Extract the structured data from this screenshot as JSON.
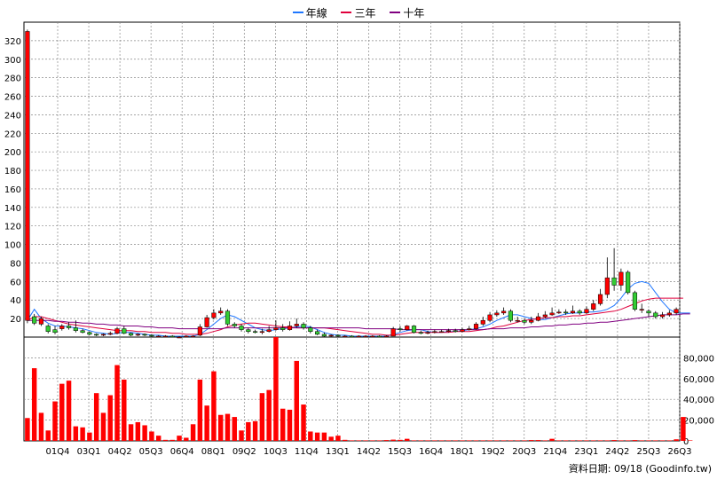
{
  "chart_data": {
    "type": "candlestick_with_volume",
    "legend": [
      {
        "label": "年線",
        "color": "#1f77ff"
      },
      {
        "label": "三年",
        "color": "#e0003c"
      },
      {
        "label": "十年",
        "color": "#800080"
      }
    ],
    "price_axis": {
      "ylim": [
        0,
        340
      ],
      "ticks": [
        20,
        40,
        60,
        80,
        100,
        120,
        140,
        160,
        180,
        200,
        220,
        240,
        260,
        280,
        300,
        320
      ]
    },
    "volume_axis": {
      "ylim": [
        0,
        100000
      ],
      "ticks": [
        "0",
        "20,000",
        "40,000",
        "60,000",
        "80,000"
      ],
      "tick_values": [
        0,
        20000,
        40000,
        60000,
        80000
      ]
    },
    "x_labels": [
      "01Q4",
      "03Q1",
      "04Q2",
      "05Q3",
      "06Q4",
      "08Q1",
      "09Q2",
      "10Q3",
      "11Q4",
      "13Q1",
      "14Q2",
      "15Q3",
      "16Q4",
      "18Q1",
      "19Q2",
      "20Q3",
      "21Q4",
      "23Q1",
      "24Q2",
      "25Q3",
      "26Q3"
    ],
    "candles": [
      {
        "o": 18,
        "c": 330,
        "h": 332,
        "l": 15
      },
      {
        "o": 22,
        "c": 15,
        "h": 25,
        "l": 13
      },
      {
        "o": 14,
        "c": 20,
        "h": 22,
        "l": 12
      },
      {
        "o": 12,
        "c": 6,
        "h": 14,
        "l": 4
      },
      {
        "o": 8,
        "c": 5,
        "h": 12,
        "l": 3
      },
      {
        "o": 9,
        "c": 12,
        "h": 14,
        "l": 7
      },
      {
        "o": 12,
        "c": 10,
        "h": 16,
        "l": 8
      },
      {
        "o": 10,
        "c": 7,
        "h": 18,
        "l": 5
      },
      {
        "o": 7,
        "c": 5,
        "h": 9,
        "l": 4
      },
      {
        "o": 5,
        "c": 3,
        "h": 6,
        "l": 2
      },
      {
        "o": 3,
        "c": 2,
        "h": 4,
        "l": 1
      },
      {
        "o": 2,
        "c": 3,
        "h": 4,
        "l": 1
      },
      {
        "o": 3,
        "c": 4,
        "h": 6,
        "l": 2
      },
      {
        "o": 4,
        "c": 9,
        "h": 11,
        "l": 3
      },
      {
        "o": 9,
        "c": 4,
        "h": 12,
        "l": 3
      },
      {
        "o": 4,
        "c": 2,
        "h": 5,
        "l": 1
      },
      {
        "o": 2,
        "c": 3,
        "h": 4,
        "l": 1
      },
      {
        "o": 3,
        "c": 2,
        "h": 4,
        "l": 1
      },
      {
        "o": 2,
        "c": 1,
        "h": 3,
        "l": 0
      },
      {
        "o": 1,
        "c": 1,
        "h": 2,
        "l": 0
      },
      {
        "o": 1,
        "c": 1,
        "h": 2,
        "l": 0
      },
      {
        "o": 1,
        "c": 0,
        "h": 2,
        "l": 0
      },
      {
        "o": 0,
        "c": 0,
        "h": 1,
        "l": 0
      },
      {
        "o": 0,
        "c": 1,
        "h": 2,
        "l": 0
      },
      {
        "o": 1,
        "c": 1,
        "h": 2,
        "l": 0
      },
      {
        "o": 2,
        "c": 11,
        "h": 14,
        "l": 1
      },
      {
        "o": 11,
        "c": 21,
        "h": 24,
        "l": 10
      },
      {
        "o": 21,
        "c": 26,
        "h": 30,
        "l": 19
      },
      {
        "o": 26,
        "c": 28,
        "h": 32,
        "l": 24
      },
      {
        "o": 28,
        "c": 14,
        "h": 30,
        "l": 12
      },
      {
        "o": 14,
        "c": 12,
        "h": 16,
        "l": 10
      },
      {
        "o": 12,
        "c": 8,
        "h": 14,
        "l": 6
      },
      {
        "o": 8,
        "c": 6,
        "h": 10,
        "l": 4
      },
      {
        "o": 6,
        "c": 5,
        "h": 8,
        "l": 4
      },
      {
        "o": 5,
        "c": 6,
        "h": 9,
        "l": 3
      },
      {
        "o": 6,
        "c": 8,
        "h": 12,
        "l": 5
      },
      {
        "o": 8,
        "c": 10,
        "h": 18,
        "l": 7
      },
      {
        "o": 10,
        "c": 8,
        "h": 14,
        "l": 6
      },
      {
        "o": 8,
        "c": 12,
        "h": 17,
        "l": 7
      },
      {
        "o": 12,
        "c": 14,
        "h": 20,
        "l": 10
      },
      {
        "o": 14,
        "c": 10,
        "h": 16,
        "l": 8
      },
      {
        "o": 10,
        "c": 6,
        "h": 12,
        "l": 4
      },
      {
        "o": 6,
        "c": 3,
        "h": 8,
        "l": 2
      },
      {
        "o": 3,
        "c": 1,
        "h": 5,
        "l": 0
      },
      {
        "o": 1,
        "c": 2,
        "h": 3,
        "l": 0
      },
      {
        "o": 2,
        "c": 1,
        "h": 3,
        "l": 0
      },
      {
        "o": 1,
        "c": 1,
        "h": 2,
        "l": 0
      },
      {
        "o": 1,
        "c": 0,
        "h": 2,
        "l": 0
      },
      {
        "o": 0,
        "c": 1,
        "h": 2,
        "l": 0
      },
      {
        "o": 1,
        "c": 1,
        "h": 2,
        "l": 0
      },
      {
        "o": 1,
        "c": 1,
        "h": 2,
        "l": 0
      },
      {
        "o": 1,
        "c": 0,
        "h": 2,
        "l": 0
      },
      {
        "o": 0,
        "c": 1,
        "h": 2,
        "l": 0
      },
      {
        "o": 1,
        "c": 9,
        "h": 11,
        "l": 1
      },
      {
        "o": 9,
        "c": 8,
        "h": 12,
        "l": 6
      },
      {
        "o": 8,
        "c": 12,
        "h": 13,
        "l": 7
      },
      {
        "o": 12,
        "c": 5,
        "h": 13,
        "l": 4
      },
      {
        "o": 5,
        "c": 4,
        "h": 7,
        "l": 3
      },
      {
        "o": 4,
        "c": 5,
        "h": 7,
        "l": 3
      },
      {
        "o": 5,
        "c": 6,
        "h": 8,
        "l": 4
      },
      {
        "o": 6,
        "c": 6,
        "h": 8,
        "l": 5
      },
      {
        "o": 6,
        "c": 7,
        "h": 9,
        "l": 5
      },
      {
        "o": 7,
        "c": 6,
        "h": 9,
        "l": 5
      },
      {
        "o": 6,
        "c": 8,
        "h": 10,
        "l": 5
      },
      {
        "o": 8,
        "c": 9,
        "h": 12,
        "l": 7
      },
      {
        "o": 9,
        "c": 14,
        "h": 16,
        "l": 8
      },
      {
        "o": 14,
        "c": 18,
        "h": 22,
        "l": 12
      },
      {
        "o": 18,
        "c": 24,
        "h": 27,
        "l": 16
      },
      {
        "o": 24,
        "c": 26,
        "h": 29,
        "l": 22
      },
      {
        "o": 26,
        "c": 28,
        "h": 32,
        "l": 24
      },
      {
        "o": 28,
        "c": 18,
        "h": 30,
        "l": 16
      },
      {
        "o": 18,
        "c": 18,
        "h": 22,
        "l": 16
      },
      {
        "o": 18,
        "c": 16,
        "h": 20,
        "l": 14
      },
      {
        "o": 16,
        "c": 18,
        "h": 22,
        "l": 14
      },
      {
        "o": 18,
        "c": 22,
        "h": 26,
        "l": 17
      },
      {
        "o": 22,
        "c": 24,
        "h": 28,
        "l": 20
      },
      {
        "o": 24,
        "c": 26,
        "h": 32,
        "l": 23
      },
      {
        "o": 26,
        "c": 27,
        "h": 30,
        "l": 25
      },
      {
        "o": 27,
        "c": 26,
        "h": 30,
        "l": 24
      },
      {
        "o": 26,
        "c": 28,
        "h": 34,
        "l": 25
      },
      {
        "o": 28,
        "c": 26,
        "h": 30,
        "l": 24
      },
      {
        "o": 26,
        "c": 30,
        "h": 33,
        "l": 25
      },
      {
        "o": 30,
        "c": 36,
        "h": 40,
        "l": 28
      },
      {
        "o": 36,
        "c": 46,
        "h": 52,
        "l": 34
      },
      {
        "o": 46,
        "c": 64,
        "h": 86,
        "l": 42
      },
      {
        "o": 64,
        "c": 56,
        "h": 96,
        "l": 50
      },
      {
        "o": 56,
        "c": 70,
        "h": 74,
        "l": 50
      },
      {
        "o": 70,
        "c": 48,
        "h": 72,
        "l": 46
      },
      {
        "o": 48,
        "c": 30,
        "h": 50,
        "l": 28
      },
      {
        "o": 30,
        "c": 30,
        "h": 36,
        "l": 26
      },
      {
        "o": 28,
        "c": 26,
        "h": 30,
        "l": 22
      },
      {
        "o": 26,
        "c": 22,
        "h": 28,
        "l": 20
      },
      {
        "o": 22,
        "c": 24,
        "h": 27,
        "l": 20
      },
      {
        "o": 24,
        "c": 26,
        "h": 29,
        "l": 22
      },
      {
        "o": 26,
        "c": 30,
        "h": 32,
        "l": 24
      }
    ],
    "series": [
      {
        "name": "年線",
        "values": [
          18,
          30,
          20,
          15,
          12,
          12,
          11,
          10,
          9,
          7,
          5,
          4,
          3,
          4,
          5,
          5,
          4,
          3,
          2,
          2,
          1,
          1,
          1,
          1,
          1,
          3,
          8,
          14,
          20,
          24,
          22,
          18,
          14,
          10,
          8,
          7,
          8,
          9,
          10,
          11,
          12,
          11,
          8,
          5,
          3,
          2,
          2,
          1,
          1,
          1,
          1,
          1,
          1,
          3,
          5,
          7,
          8,
          8,
          6,
          5,
          5,
          6,
          6,
          7,
          8,
          9,
          11,
          14,
          18,
          21,
          24,
          24,
          22,
          20,
          19,
          19,
          21,
          23,
          25,
          26,
          26,
          27,
          27,
          28,
          30,
          34,
          42,
          52,
          58,
          60,
          58,
          48,
          38,
          30,
          26,
          26,
          26
        ]
      },
      {
        "name": "三年",
        "values": [
          18,
          22,
          22,
          20,
          18,
          16,
          14,
          13,
          12,
          11,
          10,
          9,
          8,
          7,
          7,
          7,
          6,
          6,
          5,
          5,
          5,
          4,
          4,
          3,
          3,
          3,
          4,
          6,
          8,
          11,
          13,
          14,
          15,
          15,
          14,
          13,
          12,
          11,
          11,
          10,
          10,
          10,
          10,
          10,
          9,
          8,
          7,
          6,
          5,
          4,
          3,
          3,
          2,
          2,
          3,
          4,
          5,
          5,
          5,
          5,
          5,
          5,
          6,
          6,
          6,
          7,
          8,
          9,
          11,
          12,
          14,
          16,
          18,
          19,
          20,
          21,
          21,
          22,
          22,
          23,
          23,
          24,
          25,
          26,
          27,
          28,
          30,
          33,
          36,
          39,
          41,
          42,
          42,
          42,
          42,
          42
        ]
      },
      {
        "name": "十年",
        "values": [
          18,
          18,
          18,
          18,
          17,
          17,
          16,
          16,
          15,
          15,
          14,
          14,
          13,
          13,
          12,
          12,
          12,
          11,
          11,
          10,
          10,
          10,
          9,
          9,
          9,
          9,
          9,
          9,
          9,
          10,
          10,
          10,
          10,
          10,
          10,
          10,
          10,
          10,
          10,
          10,
          10,
          10,
          10,
          10,
          10,
          10,
          10,
          10,
          10,
          9,
          9,
          9,
          9,
          9,
          8,
          8,
          8,
          8,
          8,
          8,
          8,
          8,
          8,
          8,
          8,
          8,
          8,
          9,
          9,
          9,
          10,
          10,
          10,
          11,
          11,
          12,
          12,
          13,
          13,
          14,
          14,
          15,
          15,
          16,
          16,
          17,
          18,
          19,
          20,
          21,
          22,
          23,
          24,
          24,
          24,
          25,
          25
        ]
      }
    ],
    "volume": [
      22000,
      70000,
      27000,
      10000,
      38000,
      55000,
      58000,
      14000,
      13000,
      8000,
      46000,
      27000,
      44000,
      73000,
      59000,
      16000,
      18000,
      15000,
      9000,
      5000,
      1000,
      1000,
      5000,
      3000,
      16000,
      59000,
      34000,
      67000,
      25000,
      26000,
      23000,
      10000,
      18000,
      19000,
      46000,
      49000,
      100000,
      31000,
      30000,
      77000,
      35000,
      9000,
      8000,
      8000,
      4000,
      5000,
      1000,
      500,
      500,
      500,
      500,
      500,
      800,
      1200,
      1000,
      2000,
      500,
      500,
      500,
      500,
      500,
      500,
      500,
      500,
      500,
      500,
      500,
      500,
      500,
      500,
      500,
      500,
      500,
      800,
      800,
      500,
      2000,
      500,
      500,
      500,
      500,
      500,
      500,
      500,
      500,
      800,
      500,
      500,
      800,
      500,
      500,
      500,
      500,
      500,
      1500,
      23000,
      500
    ]
  },
  "footer": "資料日期: 09/18  (Goodinfo.tw)"
}
